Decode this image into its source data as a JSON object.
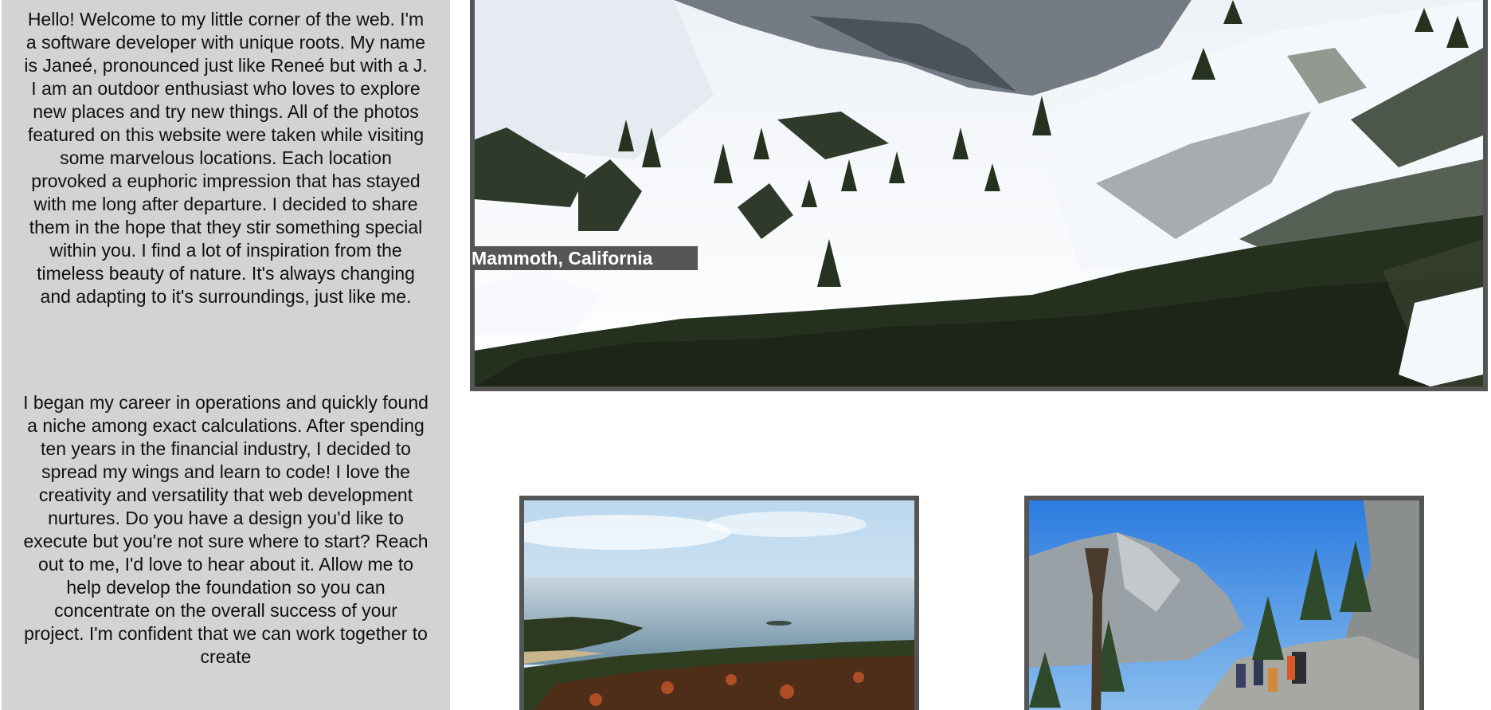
{
  "about": {
    "paragraph_1": "Hello! Welcome to my little corner of the web. I'm a software developer with unique roots. My name is Janeé, pronounced just like Reneé but with a J. I am an outdoor enthusiast who loves to explore new places and try new things. All of the photos featured on this website were taken while visiting some marvelous locations. Each location provoked a euphoric impression that has stayed with me long after departure. I decided to share them in the hope that they stir something special within you. I find a lot of inspiration from the timeless beauty of nature. It's always changing and adapting to it's surroundings, just like me.",
    "paragraph_2": "I began my career in operations and quickly found a niche among exact calculations. After spending ten years in the financial industry, I decided to spread my wings and learn to code! I love the creativity and versatility that web development nurtures. Do you have a design you'd like to execute but you're not sure where to start? Reach out to me, I'd love to hear about it. Allow me to help develop the foundation so you can concentrate on the overall success of your project. I'm confident that we can work together to create"
  },
  "gallery": {
    "hero_caption": "Mammoth, California"
  },
  "colors": {
    "sidebar_bg": "#d3d3d3",
    "frame_border": "#555555",
    "caption_bg": "#555555",
    "caption_text": "#ffffff"
  }
}
